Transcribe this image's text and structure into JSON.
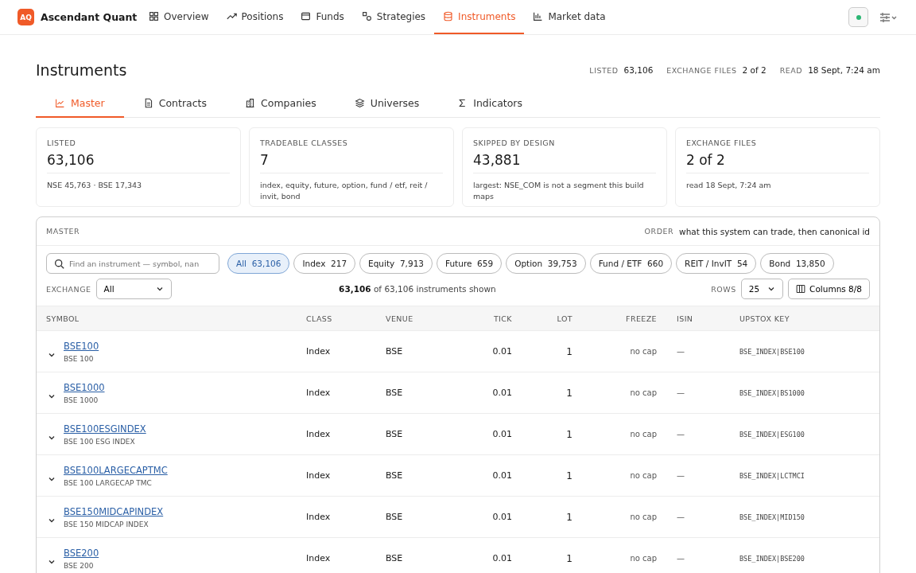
{
  "brand": {
    "logo": "AQ",
    "name": "Ascendant Quant"
  },
  "nav": [
    {
      "label": "Overview",
      "selected": false
    },
    {
      "label": "Positions",
      "selected": false
    },
    {
      "label": "Funds",
      "selected": false
    },
    {
      "label": "Strategies",
      "selected": false
    },
    {
      "label": "Instruments",
      "selected": true
    },
    {
      "label": "Market data",
      "selected": false
    }
  ],
  "page": {
    "title": "Instruments",
    "meta": [
      {
        "label": "LISTED",
        "value": "63,106"
      },
      {
        "label": "EXCHANGE FILES",
        "value": "2 of 2"
      },
      {
        "label": "READ",
        "value": "18 Sept, 7:24 am"
      }
    ]
  },
  "subtabs": [
    {
      "label": "Master",
      "selected": true
    },
    {
      "label": "Contracts",
      "selected": false
    },
    {
      "label": "Companies",
      "selected": false
    },
    {
      "label": "Universes",
      "selected": false
    },
    {
      "label": "Indicators",
      "selected": false
    }
  ],
  "cards": [
    {
      "label": "LISTED",
      "value": "63,106",
      "note": "NSE 45,763 · BSE 17,343"
    },
    {
      "label": "TRADEABLE CLASSES",
      "value": "7",
      "note": "index, equity, future, option, fund / etf, reit / invit, bond"
    },
    {
      "label": "SKIPPED BY DESIGN",
      "value": "43,881",
      "note": "largest: NSE_COM is not a segment this build maps"
    },
    {
      "label": "EXCHANGE FILES",
      "value": "2 of 2",
      "note": "read 18 Sept, 7:24 am"
    }
  ],
  "master": {
    "title": "MASTER",
    "order_label": "ORDER",
    "order_value": "what this system can trade, then canonical id",
    "search": {
      "placeholder": "Find an instrument — symbol, nan"
    },
    "filters": [
      {
        "label": "All",
        "count": "63,106",
        "selected": true
      },
      {
        "label": "Index",
        "count": "217",
        "selected": false
      },
      {
        "label": "Equity",
        "count": "7,913",
        "selected": false
      },
      {
        "label": "Future",
        "count": "659",
        "selected": false
      },
      {
        "label": "Option",
        "count": "39,753",
        "selected": false
      },
      {
        "label": "Fund / ETF",
        "count": "660",
        "selected": false
      },
      {
        "label": "REIT / InvIT",
        "count": "54",
        "selected": false
      },
      {
        "label": "Bond",
        "count": "13,850",
        "selected": false
      }
    ],
    "exchange_label": "EXCHANGE",
    "exchange_value": "All",
    "shown_count": "63,106",
    "shown_text": "of 63,106 instruments shown",
    "rows_label": "ROWS",
    "rows_value": "25",
    "columns_button": "Columns 8/8",
    "columns": [
      "SYMBOL",
      "CLASS",
      "VENUE",
      "TICK",
      "LOT",
      "FREEZE",
      "ISIN",
      "UPSTOX KEY"
    ],
    "rows": [
      {
        "symbol": "BSE100",
        "name": "BSE 100",
        "class": "Index",
        "venue": "BSE",
        "tick": "0.01",
        "lot": "1",
        "freeze": "no cap",
        "isin": "—",
        "key": "BSE_INDEX|BSE100",
        "expanded": false
      },
      {
        "symbol": "BSE1000",
        "name": "BSE 1000",
        "class": "Index",
        "venue": "BSE",
        "tick": "0.01",
        "lot": "1",
        "freeze": "no cap",
        "isin": "—",
        "key": "BSE_INDEX|BS1000",
        "expanded": false
      },
      {
        "symbol": "BSE100ESGINDEX",
        "name": "BSE 100 ESG INDEX",
        "class": "Index",
        "venue": "BSE",
        "tick": "0.01",
        "lot": "1",
        "freeze": "no cap",
        "isin": "—",
        "key": "BSE_INDEX|ESG100",
        "expanded": false
      },
      {
        "symbol": "BSE100LARGECAPTMC",
        "name": "BSE 100 LARGECAP TMC",
        "class": "Index",
        "venue": "BSE",
        "tick": "0.01",
        "lot": "1",
        "freeze": "no cap",
        "isin": "—",
        "key": "BSE_INDEX|LCTMCI",
        "expanded": false
      },
      {
        "symbol": "BSE150MIDCAPINDEX",
        "name": "BSE 150 MIDCAP INDEX",
        "class": "Index",
        "venue": "BSE",
        "tick": "0.01",
        "lot": "1",
        "freeze": "no cap",
        "isin": "—",
        "key": "BSE_INDEX|MID150",
        "expanded": false
      },
      {
        "symbol": "BSE200",
        "name": "BSE 200",
        "class": "Index",
        "venue": "BSE",
        "tick": "0.01",
        "lot": "1",
        "freeze": "no cap",
        "isin": "—",
        "key": "BSE_INDEX|BSE200",
        "expanded": false
      }
    ]
  }
}
